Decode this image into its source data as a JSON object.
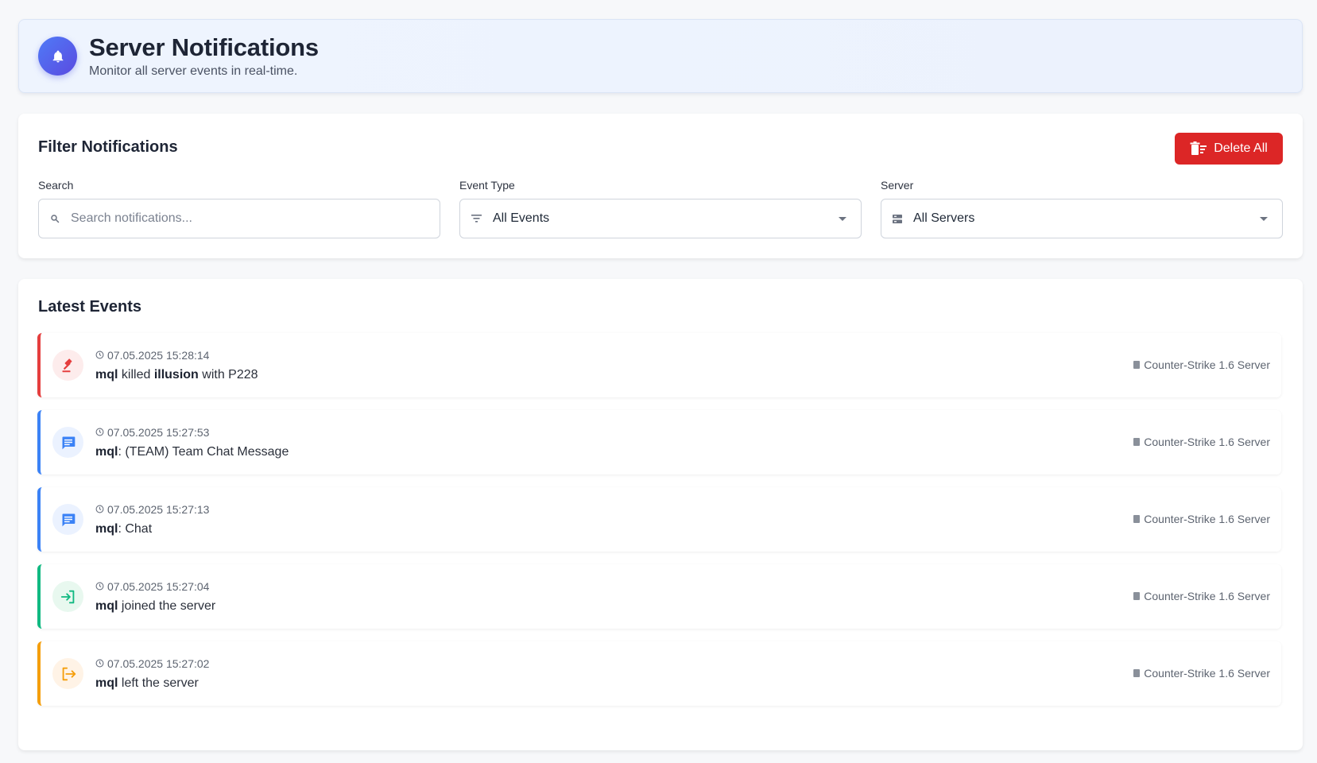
{
  "header": {
    "title": "Server Notifications",
    "subtitle": "Monitor all server events in real-time."
  },
  "filters": {
    "title": "Filter Notifications",
    "delete_all_label": "Delete All",
    "search": {
      "label": "Search",
      "placeholder": "Search notifications...",
      "value": ""
    },
    "event_type": {
      "label": "Event Type",
      "value": "All Events"
    },
    "server": {
      "label": "Server",
      "value": "All Servers"
    }
  },
  "events": {
    "title": "Latest Events",
    "items": [
      {
        "type": "kill",
        "icon": "gavel-icon",
        "color": "#e53e3e",
        "time": "07.05.2025 15:28:14",
        "player": "mql",
        "mid": " killed ",
        "target": "illusion",
        "tail": " with P228",
        "server": "Counter-Strike 1.6 Server"
      },
      {
        "type": "chat",
        "icon": "chat-icon",
        "color": "#3b82f6",
        "time": "07.05.2025 15:27:53",
        "player": "mql",
        "mid": ": (TEAM) Team Chat Message",
        "target": "",
        "tail": "",
        "server": "Counter-Strike 1.6 Server"
      },
      {
        "type": "chat",
        "icon": "chat-icon",
        "color": "#3b82f6",
        "time": "07.05.2025 15:27:13",
        "player": "mql",
        "mid": ": Chat",
        "target": "",
        "tail": "",
        "server": "Counter-Strike 1.6 Server"
      },
      {
        "type": "join",
        "icon": "login-icon",
        "color": "#10b981",
        "time": "07.05.2025 15:27:04",
        "player": "mql",
        "mid": " joined the server",
        "target": "",
        "tail": "",
        "server": "Counter-Strike 1.6 Server"
      },
      {
        "type": "leave",
        "icon": "logout-icon",
        "color": "#f59e0b",
        "time": "07.05.2025 15:27:02",
        "player": "mql",
        "mid": " left the server",
        "target": "",
        "tail": "",
        "server": "Counter-Strike 1.6 Server"
      }
    ]
  },
  "colors": {
    "accent": "#4f7bf7",
    "danger": "#dc2626"
  }
}
